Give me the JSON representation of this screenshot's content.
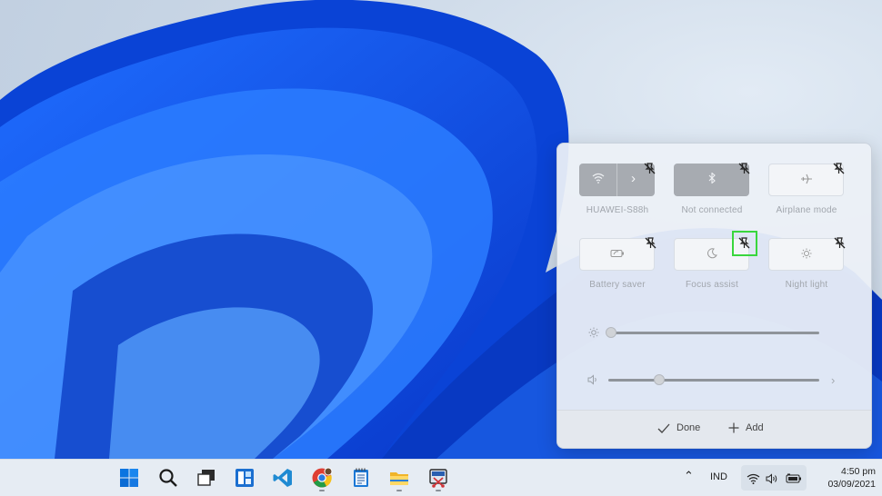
{
  "quick_settings": {
    "tiles": [
      {
        "label": "HUAWEI-S88h",
        "icon": "wifi-icon",
        "state": "on"
      },
      {
        "label": "Not connected",
        "icon": "bluetooth-icon",
        "state": "on"
      },
      {
        "label": "Airplane mode",
        "icon": "airplane-icon",
        "state": "off"
      },
      {
        "label": "Battery saver",
        "icon": "battery-saver-icon",
        "state": "off"
      },
      {
        "label": "Focus assist",
        "icon": "moon-icon",
        "state": "off"
      },
      {
        "label": "Night light",
        "icon": "sun-icon",
        "state": "off"
      }
    ],
    "brightness_level": 0.0,
    "volume_level": 0.24,
    "footer": {
      "done_label": "Done",
      "add_label": "Add"
    }
  },
  "taskbar": {
    "apps": [
      "start-icon",
      "search-icon",
      "task-view-icon",
      "widgets-icon",
      "vscode-icon",
      "chrome-icon",
      "notepad-icon",
      "file-explorer-icon",
      "snipping-tool-icon"
    ],
    "language": "IND",
    "time": "4:50 pm",
    "date": "03/09/2021"
  },
  "colors": {
    "highlight": "#39d63d",
    "accent": "#0067c0"
  }
}
